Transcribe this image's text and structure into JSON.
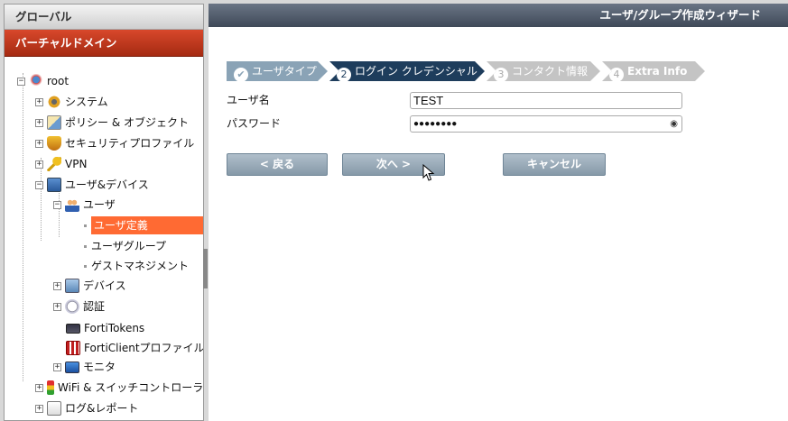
{
  "sidebar": {
    "header": "グローバル",
    "vdom": "バーチャルドメイン",
    "tree": {
      "root": "root",
      "system": "システム",
      "policy": "ポリシー & オブジェクト",
      "security": "セキュリティプロファイル",
      "vpn": "VPN",
      "user_device": "ユーザ&デバイス",
      "user": "ユーザ",
      "user_definition": "ユーザ定義",
      "user_group": "ユーザグループ",
      "guest": "ゲストマネジメント",
      "device": "デバイス",
      "auth": "認証",
      "fortitokens": "FortiTokens",
      "forticlient": "FortiClientプロファイル",
      "monitor": "モニタ",
      "wifi": "WiFi & スイッチコントローラー",
      "log": "ログ&レポート"
    }
  },
  "main": {
    "title": "ユーザ/グループ作成ウィザード",
    "steps": [
      {
        "num": "✔",
        "label": "ユーザタイプ"
      },
      {
        "num": "2",
        "label": "ログイン クレデンシャル"
      },
      {
        "num": "3",
        "label": "コンタクト情報"
      },
      {
        "num": "4",
        "label": "Extra Info"
      }
    ],
    "username_label": "ユーザ名",
    "username_value": "TEST",
    "password_label": "パスワード",
    "password_value": "●●●●●●●●",
    "eye_icon": "◉",
    "back_label": "< 戻る",
    "next_label": "次へ >",
    "cancel_label": "キャンセル"
  }
}
